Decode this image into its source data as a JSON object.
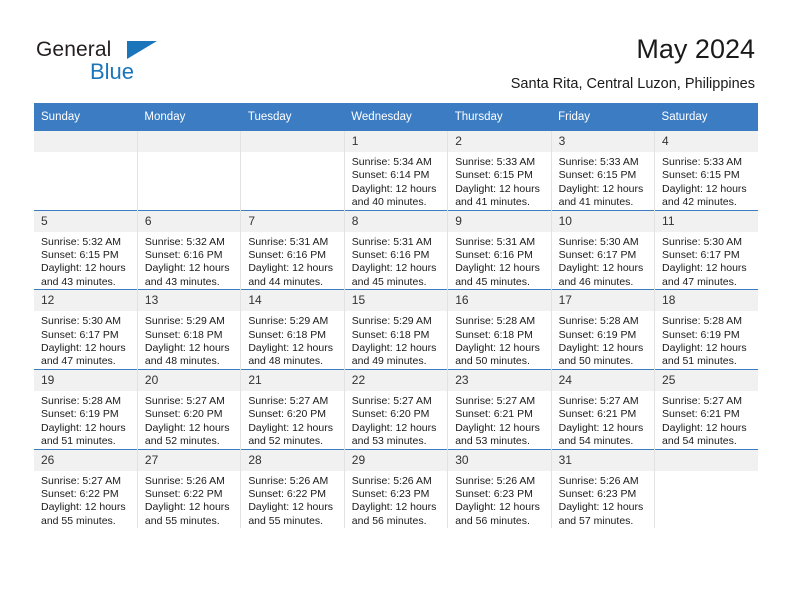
{
  "brand": {
    "name_dark": "General",
    "name_light": "Blue",
    "accent_color": "#1b75bb"
  },
  "header": {
    "title": "May 2024",
    "subtitle": "Santa Rita, Central Luzon, Philippines"
  },
  "theme": {
    "header_row_bg": "#3c7cc3",
    "daynum_bg": "#f1f1f1",
    "row_divider": "#3c7cc3",
    "column_divider": "#e2e2e2"
  },
  "weekdays": [
    "Sunday",
    "Monday",
    "Tuesday",
    "Wednesday",
    "Thursday",
    "Friday",
    "Saturday"
  ],
  "weeks": [
    [
      {
        "day": "",
        "empty": true
      },
      {
        "day": "",
        "empty": true
      },
      {
        "day": "",
        "empty": true
      },
      {
        "day": "1",
        "sunrise": "Sunrise: 5:34 AM",
        "sunset": "Sunset: 6:14 PM",
        "daylight1": "Daylight: 12 hours",
        "daylight2": "and 40 minutes."
      },
      {
        "day": "2",
        "sunrise": "Sunrise: 5:33 AM",
        "sunset": "Sunset: 6:15 PM",
        "daylight1": "Daylight: 12 hours",
        "daylight2": "and 41 minutes."
      },
      {
        "day": "3",
        "sunrise": "Sunrise: 5:33 AM",
        "sunset": "Sunset: 6:15 PM",
        "daylight1": "Daylight: 12 hours",
        "daylight2": "and 41 minutes."
      },
      {
        "day": "4",
        "sunrise": "Sunrise: 5:33 AM",
        "sunset": "Sunset: 6:15 PM",
        "daylight1": "Daylight: 12 hours",
        "daylight2": "and 42 minutes."
      }
    ],
    [
      {
        "day": "5",
        "sunrise": "Sunrise: 5:32 AM",
        "sunset": "Sunset: 6:15 PM",
        "daylight1": "Daylight: 12 hours",
        "daylight2": "and 43 minutes."
      },
      {
        "day": "6",
        "sunrise": "Sunrise: 5:32 AM",
        "sunset": "Sunset: 6:16 PM",
        "daylight1": "Daylight: 12 hours",
        "daylight2": "and 43 minutes."
      },
      {
        "day": "7",
        "sunrise": "Sunrise: 5:31 AM",
        "sunset": "Sunset: 6:16 PM",
        "daylight1": "Daylight: 12 hours",
        "daylight2": "and 44 minutes."
      },
      {
        "day": "8",
        "sunrise": "Sunrise: 5:31 AM",
        "sunset": "Sunset: 6:16 PM",
        "daylight1": "Daylight: 12 hours",
        "daylight2": "and 45 minutes."
      },
      {
        "day": "9",
        "sunrise": "Sunrise: 5:31 AM",
        "sunset": "Sunset: 6:16 PM",
        "daylight1": "Daylight: 12 hours",
        "daylight2": "and 45 minutes."
      },
      {
        "day": "10",
        "sunrise": "Sunrise: 5:30 AM",
        "sunset": "Sunset: 6:17 PM",
        "daylight1": "Daylight: 12 hours",
        "daylight2": "and 46 minutes."
      },
      {
        "day": "11",
        "sunrise": "Sunrise: 5:30 AM",
        "sunset": "Sunset: 6:17 PM",
        "daylight1": "Daylight: 12 hours",
        "daylight2": "and 47 minutes."
      }
    ],
    [
      {
        "day": "12",
        "sunrise": "Sunrise: 5:30 AM",
        "sunset": "Sunset: 6:17 PM",
        "daylight1": "Daylight: 12 hours",
        "daylight2": "and 47 minutes."
      },
      {
        "day": "13",
        "sunrise": "Sunrise: 5:29 AM",
        "sunset": "Sunset: 6:18 PM",
        "daylight1": "Daylight: 12 hours",
        "daylight2": "and 48 minutes."
      },
      {
        "day": "14",
        "sunrise": "Sunrise: 5:29 AM",
        "sunset": "Sunset: 6:18 PM",
        "daylight1": "Daylight: 12 hours",
        "daylight2": "and 48 minutes."
      },
      {
        "day": "15",
        "sunrise": "Sunrise: 5:29 AM",
        "sunset": "Sunset: 6:18 PM",
        "daylight1": "Daylight: 12 hours",
        "daylight2": "and 49 minutes."
      },
      {
        "day": "16",
        "sunrise": "Sunrise: 5:28 AM",
        "sunset": "Sunset: 6:18 PM",
        "daylight1": "Daylight: 12 hours",
        "daylight2": "and 50 minutes."
      },
      {
        "day": "17",
        "sunrise": "Sunrise: 5:28 AM",
        "sunset": "Sunset: 6:19 PM",
        "daylight1": "Daylight: 12 hours",
        "daylight2": "and 50 minutes."
      },
      {
        "day": "18",
        "sunrise": "Sunrise: 5:28 AM",
        "sunset": "Sunset: 6:19 PM",
        "daylight1": "Daylight: 12 hours",
        "daylight2": "and 51 minutes."
      }
    ],
    [
      {
        "day": "19",
        "sunrise": "Sunrise: 5:28 AM",
        "sunset": "Sunset: 6:19 PM",
        "daylight1": "Daylight: 12 hours",
        "daylight2": "and 51 minutes."
      },
      {
        "day": "20",
        "sunrise": "Sunrise: 5:27 AM",
        "sunset": "Sunset: 6:20 PM",
        "daylight1": "Daylight: 12 hours",
        "daylight2": "and 52 minutes."
      },
      {
        "day": "21",
        "sunrise": "Sunrise: 5:27 AM",
        "sunset": "Sunset: 6:20 PM",
        "daylight1": "Daylight: 12 hours",
        "daylight2": "and 52 minutes."
      },
      {
        "day": "22",
        "sunrise": "Sunrise: 5:27 AM",
        "sunset": "Sunset: 6:20 PM",
        "daylight1": "Daylight: 12 hours",
        "daylight2": "and 53 minutes."
      },
      {
        "day": "23",
        "sunrise": "Sunrise: 5:27 AM",
        "sunset": "Sunset: 6:21 PM",
        "daylight1": "Daylight: 12 hours",
        "daylight2": "and 53 minutes."
      },
      {
        "day": "24",
        "sunrise": "Sunrise: 5:27 AM",
        "sunset": "Sunset: 6:21 PM",
        "daylight1": "Daylight: 12 hours",
        "daylight2": "and 54 minutes."
      },
      {
        "day": "25",
        "sunrise": "Sunrise: 5:27 AM",
        "sunset": "Sunset: 6:21 PM",
        "daylight1": "Daylight: 12 hours",
        "daylight2": "and 54 minutes."
      }
    ],
    [
      {
        "day": "26",
        "sunrise": "Sunrise: 5:27 AM",
        "sunset": "Sunset: 6:22 PM",
        "daylight1": "Daylight: 12 hours",
        "daylight2": "and 55 minutes."
      },
      {
        "day": "27",
        "sunrise": "Sunrise: 5:26 AM",
        "sunset": "Sunset: 6:22 PM",
        "daylight1": "Daylight: 12 hours",
        "daylight2": "and 55 minutes."
      },
      {
        "day": "28",
        "sunrise": "Sunrise: 5:26 AM",
        "sunset": "Sunset: 6:22 PM",
        "daylight1": "Daylight: 12 hours",
        "daylight2": "and 55 minutes."
      },
      {
        "day": "29",
        "sunrise": "Sunrise: 5:26 AM",
        "sunset": "Sunset: 6:23 PM",
        "daylight1": "Daylight: 12 hours",
        "daylight2": "and 56 minutes."
      },
      {
        "day": "30",
        "sunrise": "Sunrise: 5:26 AM",
        "sunset": "Sunset: 6:23 PM",
        "daylight1": "Daylight: 12 hours",
        "daylight2": "and 56 minutes."
      },
      {
        "day": "31",
        "sunrise": "Sunrise: 5:26 AM",
        "sunset": "Sunset: 6:23 PM",
        "daylight1": "Daylight: 12 hours",
        "daylight2": "and 57 minutes."
      },
      {
        "day": "",
        "empty": true
      }
    ]
  ]
}
